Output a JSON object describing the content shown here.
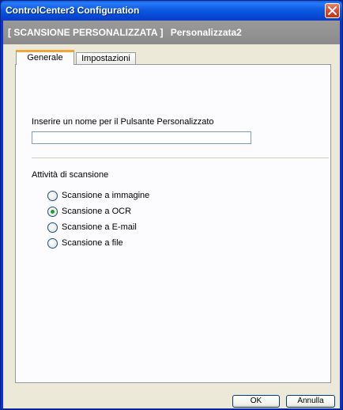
{
  "window": {
    "title": "ControlCenter3 Configuration"
  },
  "header": {
    "section": "[ SCANSIONE PERSONALIZZATA ]",
    "name": "Personalizzata2"
  },
  "tabs": [
    {
      "label": "Generale",
      "active": true
    },
    {
      "label": "Impostazioni",
      "active": false
    }
  ],
  "form": {
    "name_label": "Inserire un nome per il Pulsante Personalizzato",
    "name_value": "",
    "scan_group_label": "Attività di scansione",
    "options": [
      {
        "label": "Scansione a immagine",
        "selected": false
      },
      {
        "label": "Scansione a OCR",
        "selected": true
      },
      {
        "label": "Scansione a E-mail",
        "selected": false
      },
      {
        "label": "Scansione a file",
        "selected": false
      }
    ]
  },
  "buttons": {
    "ok": "OK",
    "cancel": "Annulla"
  },
  "colors": {
    "title_bar": "#0b5ae3",
    "header_bar": "#8f8f8f",
    "tab_highlight": "#f4a535",
    "radio_selected": "#21a121"
  }
}
